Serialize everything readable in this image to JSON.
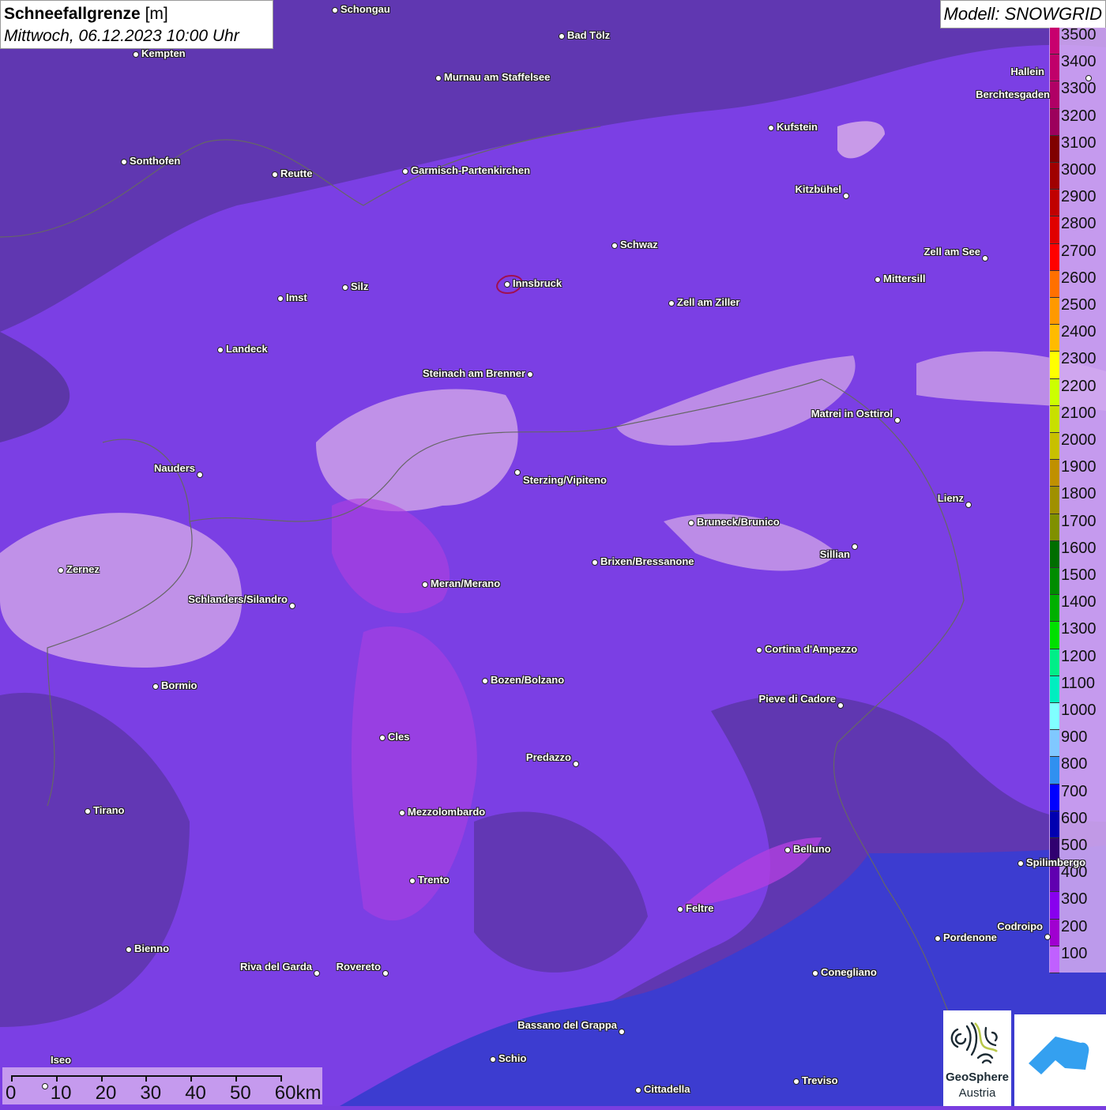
{
  "title": {
    "main": "Schneefallgrenze",
    "unit": "[m]",
    "datetime": "Mittwoch, 06.12.2023 10:00 Uhr"
  },
  "model": "Modell: SNOWGRID",
  "legend": {
    "labels": [
      "3500",
      "3400",
      "3300",
      "3200",
      "3100",
      "3000",
      "2900",
      "2800",
      "2700",
      "2600",
      "2500",
      "2400",
      "2300",
      "2200",
      "2100",
      "2000",
      "1900",
      "1800",
      "1700",
      "1600",
      "1500",
      "1400",
      "1300",
      "1200",
      "1100",
      "1000",
      "900",
      "800",
      "700",
      "600",
      "500",
      "400",
      "300",
      "200",
      "100"
    ],
    "colors": [
      "#c8006e",
      "#c0006a",
      "#b00065",
      "#9c005c",
      "#800000",
      "#a00000",
      "#c00000",
      "#e00000",
      "#ff0000",
      "#ff7000",
      "#ff9900",
      "#ffbb00",
      "#ffff00",
      "#ccff00",
      "#c8e000",
      "#c8c000",
      "#c09000",
      "#a09000",
      "#809000",
      "#006e00",
      "#008c00",
      "#00b000",
      "#00e000",
      "#00ee88",
      "#00eec0",
      "#80ffff",
      "#80c8ff",
      "#3090f0",
      "#0000ff",
      "#0000b0",
      "#300070",
      "#6000b0",
      "#8800ee",
      "#a000d0",
      "#c060ff"
    ]
  },
  "scale": {
    "ticks": [
      "0",
      "10",
      "20",
      "30",
      "40",
      "50",
      "60km"
    ]
  },
  "cities": [
    "Schongau",
    "Bad Tölz",
    "Kempten",
    "Murnau am Staffelsee",
    "Hallein",
    "Berchtesgaden",
    "Kufstein",
    "Sonthofen",
    "Reutte",
    "Garmisch-Partenkirchen",
    "Kitzbühel",
    "Schwaz",
    "Zell am See",
    "Mittersill",
    "Innsbruck",
    "Imst",
    "Silz",
    "Zell am Ziller",
    "Landeck",
    "Steinach am Brenner",
    "Matrei in Osttirol",
    "Nauders",
    "Sterzing/Vipiteno",
    "Lienz",
    "Bruneck/Brunico",
    "Sillian",
    "Zernez",
    "Brixen/Bressanone",
    "Meran/Merano",
    "Schlanders/Silandro",
    "Cortina d'Ampezzo",
    "Bozen/Bolzano",
    "Bormio",
    "Pieve di Cadore",
    "Cles",
    "Predazzo",
    "Tirano",
    "Mezzolombardo",
    "Belluno",
    "Spilimbergo",
    "Trento",
    "Feltre",
    "Pordenone",
    "Codroipo",
    "Bienno",
    "Riva del Garda",
    "Rovereto",
    "Conegliano",
    "Bassano del Grappa",
    "Schio",
    "Iseo",
    "Treviso",
    "Cittadella"
  ],
  "logos": {
    "geosphere_line1": "GeoSphere",
    "geosphere_line2": "Austria"
  }
}
